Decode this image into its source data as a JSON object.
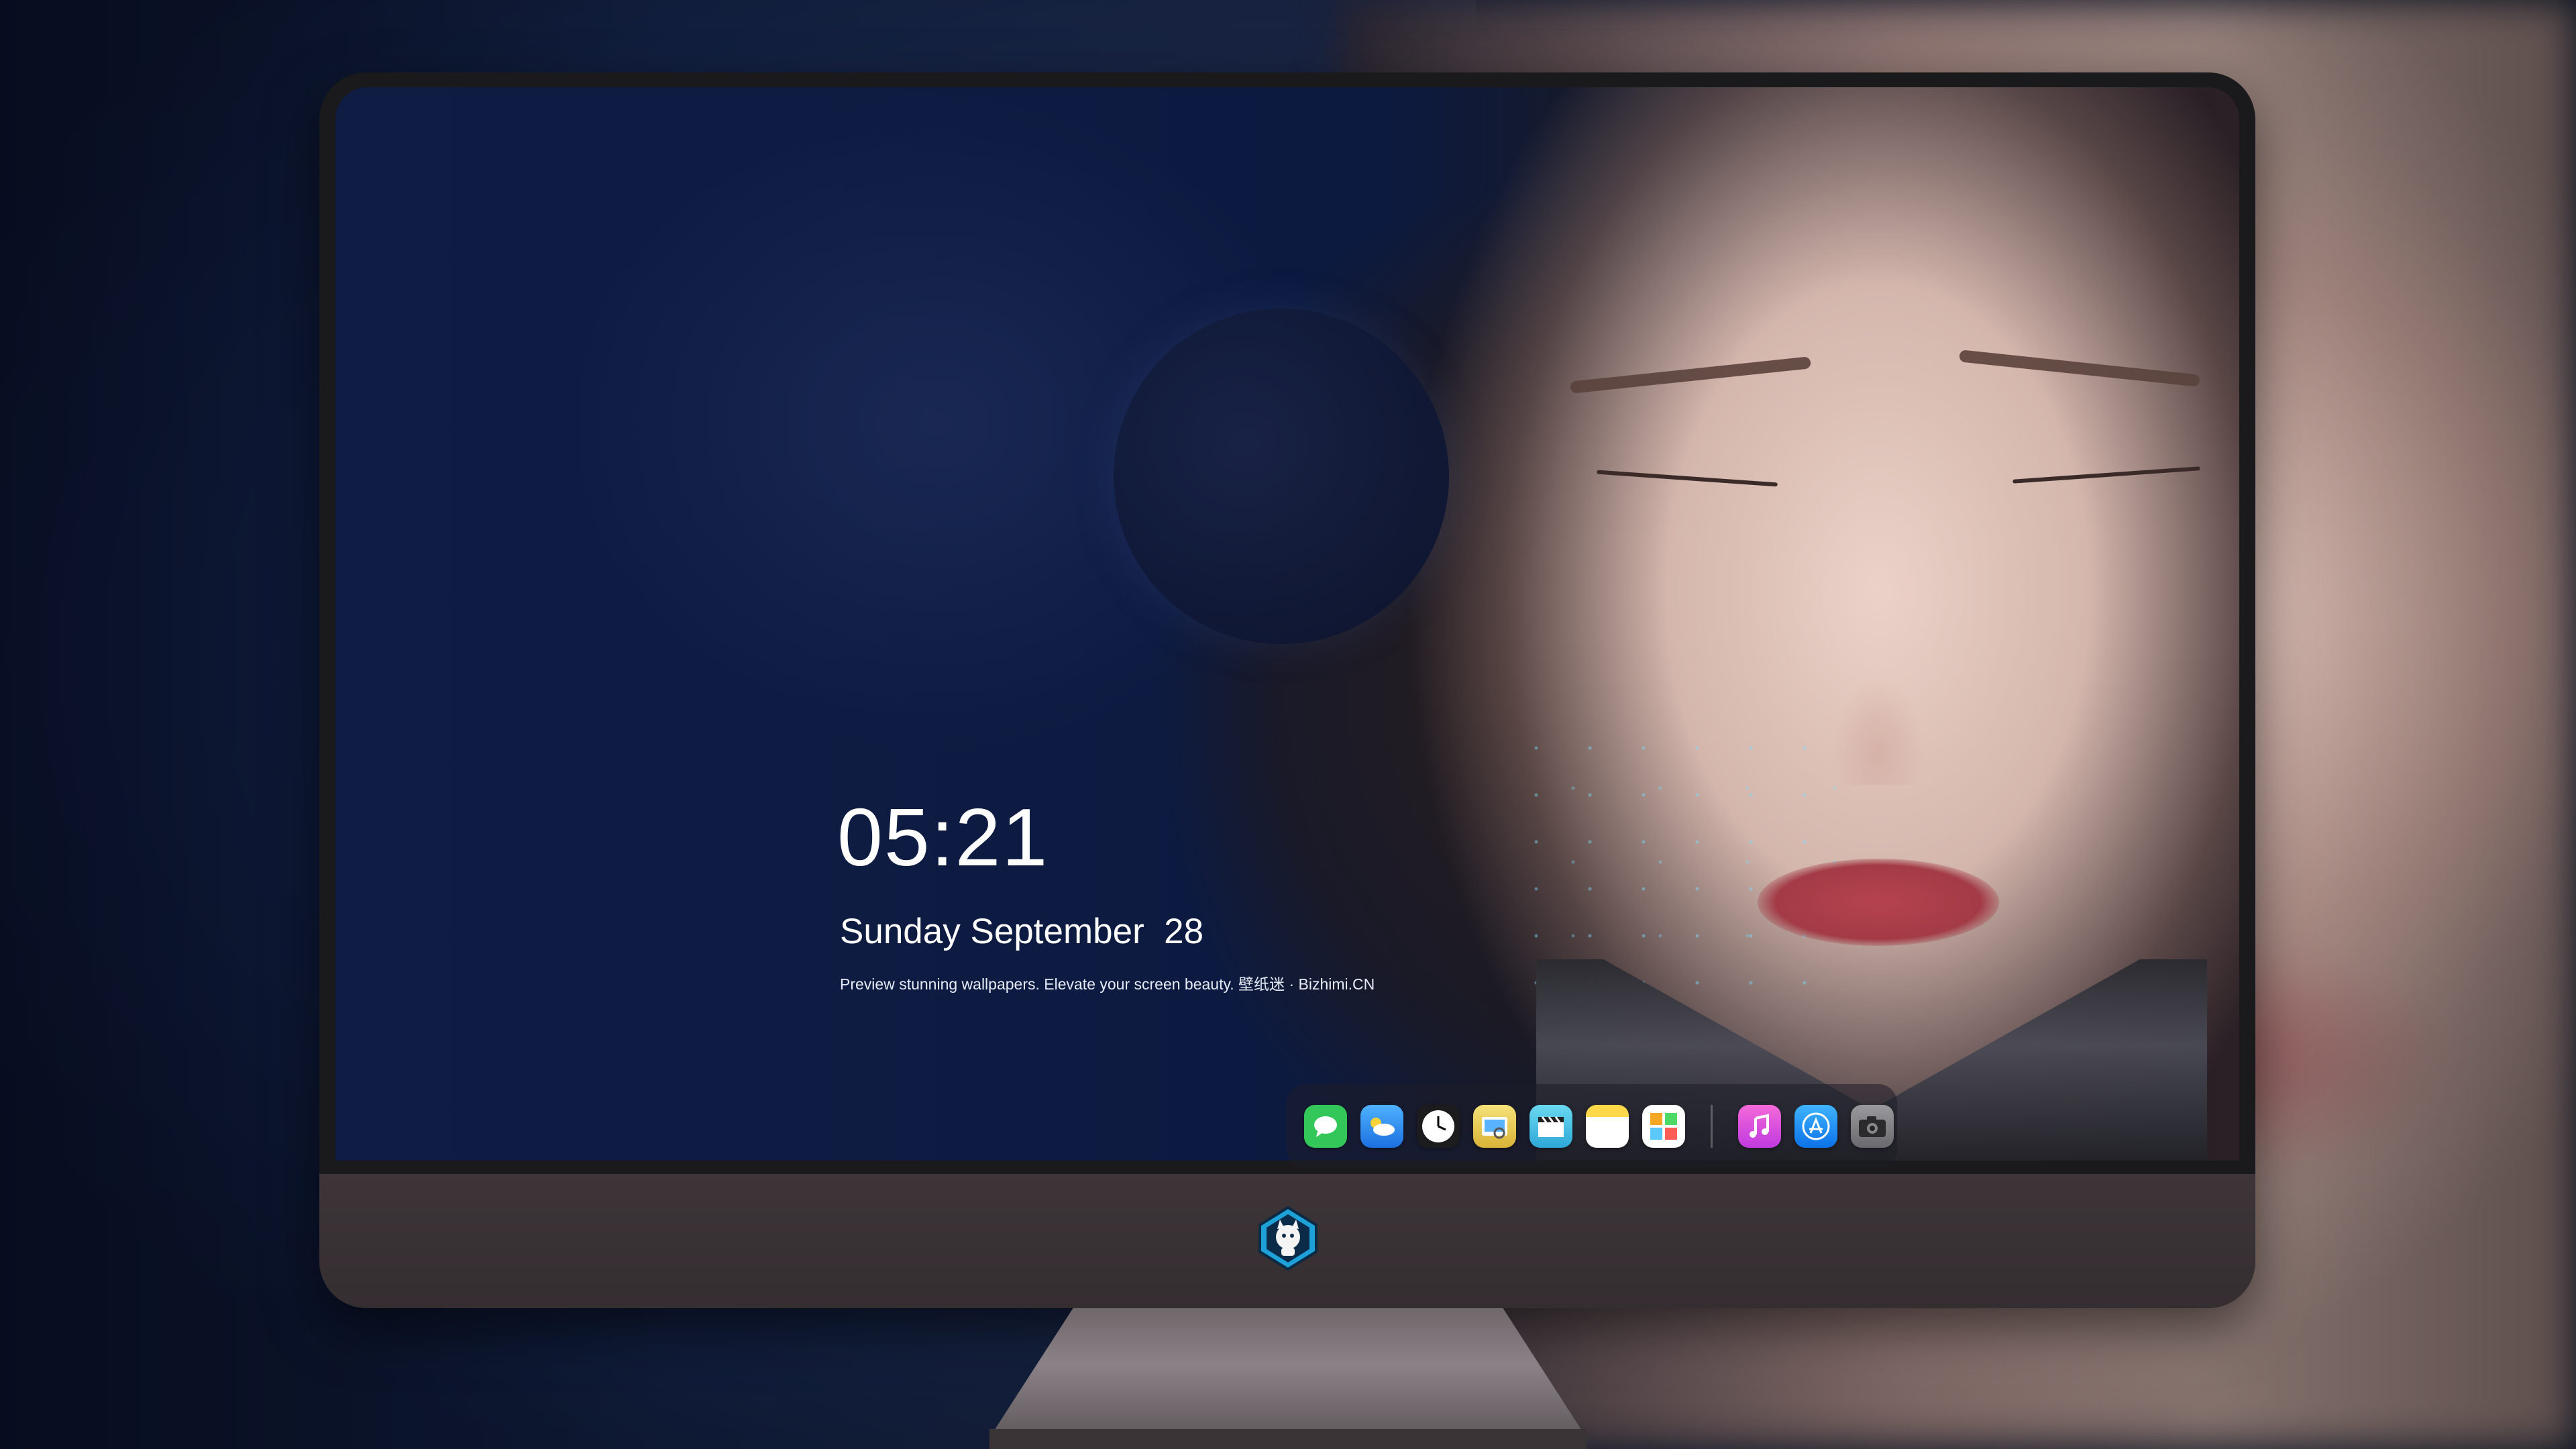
{
  "lockscreen": {
    "time": "05:21",
    "date": "Sunday September  28",
    "tagline": "Preview stunning wallpapers. Elevate your screen beauty. 壁纸迷 · Bizhimi.CN"
  },
  "dock": {
    "apps": [
      {
        "name": "messages-icon",
        "glyph": "💬",
        "color": "#33c759"
      },
      {
        "name": "weather-icon",
        "glyph": "☁",
        "color": "#2f8df5"
      },
      {
        "name": "clock-icon",
        "glyph": "🕓",
        "color": "#ffffff"
      },
      {
        "name": "preview-icon",
        "glyph": "🖼",
        "color": "#f2d34a"
      },
      {
        "name": "clips-icon",
        "glyph": "🎬",
        "color": "#45c8e8"
      },
      {
        "name": "notes-icon",
        "glyph": "",
        "color": "#ffd84a"
      },
      {
        "name": "photo-gallery-icon",
        "glyph": "▦",
        "color": "#f0a030"
      },
      {
        "name": "music-icon",
        "glyph": "♫",
        "color": "#e04fd0"
      },
      {
        "name": "app-store-icon",
        "glyph": "A",
        "color": "#1e8ef5"
      },
      {
        "name": "camera-icon",
        "glyph": "📷",
        "color": "#8a8a8e"
      }
    ]
  },
  "colors": {
    "accent_blue": "#0c1a40",
    "text": "#ffffff",
    "monitor_chin": "#3d3538"
  }
}
